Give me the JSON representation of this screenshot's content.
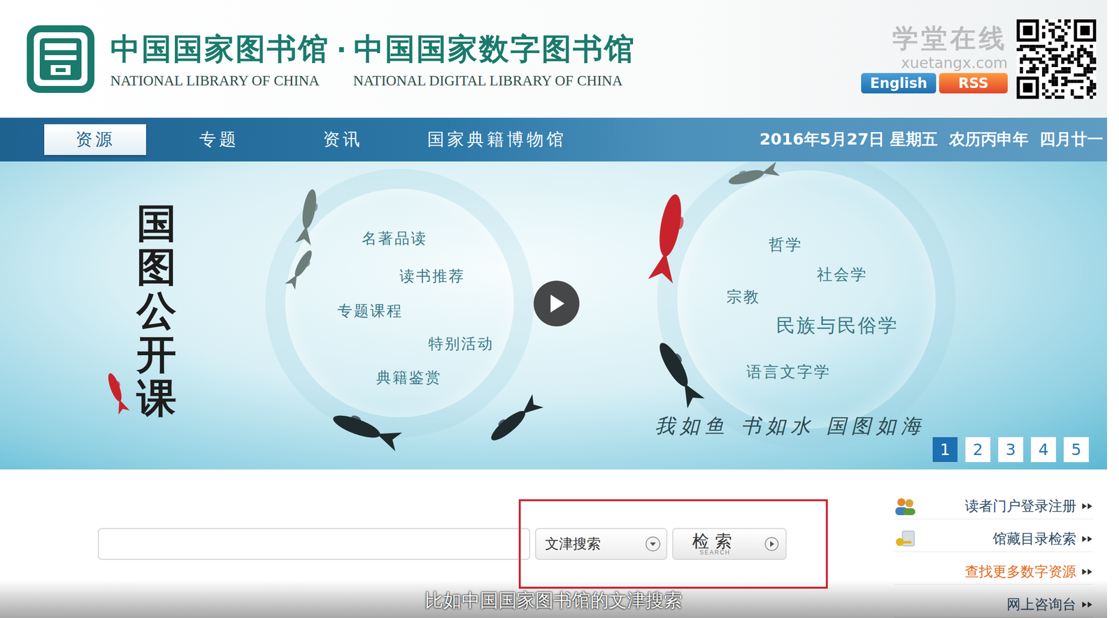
{
  "header": {
    "library_cn": "中国国家图书馆",
    "separator": "·",
    "digital_cn": "中国国家数字图书馆",
    "library_en": "NATIONAL LIBRARY OF CHINA",
    "digital_en": "NATIONAL DIGITAL LIBRARY OF CHINA"
  },
  "watermark": {
    "text": "学堂在线",
    "url": "xuetangx.com"
  },
  "header_links": [
    "English",
    "RSS"
  ],
  "nav": {
    "tabs": [
      {
        "label": "资源",
        "selected": true
      },
      {
        "label": "专题",
        "selected": false
      },
      {
        "label": "资讯",
        "selected": false
      },
      {
        "label": "国家典籍博物馆",
        "selected": false
      }
    ],
    "date": "2016年5月27日 星期五  农历丙申年  四月廿一"
  },
  "banner": {
    "title": "国图公开课",
    "left_topics": [
      "名著品读",
      "读书推荐",
      "专题课程",
      "特别活动",
      "典籍鉴赏"
    ],
    "right_topics": [
      "哲学",
      "社会学",
      "宗教",
      "民族与民俗学",
      "语言文字学"
    ],
    "slogan": "我如鱼 书如水 国图如海",
    "pages": [
      {
        "label": "1",
        "selected": true
      },
      {
        "label": "2",
        "selected": false
      },
      {
        "label": "3",
        "selected": false
      },
      {
        "label": "4",
        "selected": false
      },
      {
        "label": "5",
        "selected": false
      }
    ]
  },
  "search": {
    "value": "",
    "scope": "文津搜索",
    "button": "检索",
    "button_sub": "SEARCH"
  },
  "side_links": [
    {
      "label": "读者门户登录注册",
      "highlighted": false
    },
    {
      "label": "馆藏目录检索",
      "highlighted": false
    },
    {
      "label": "查找更多数字资源",
      "highlighted": true
    },
    {
      "label": "网上咨询台",
      "highlighted": false
    }
  ],
  "subtitle": "比如中国国家图书馆的文津搜索"
}
